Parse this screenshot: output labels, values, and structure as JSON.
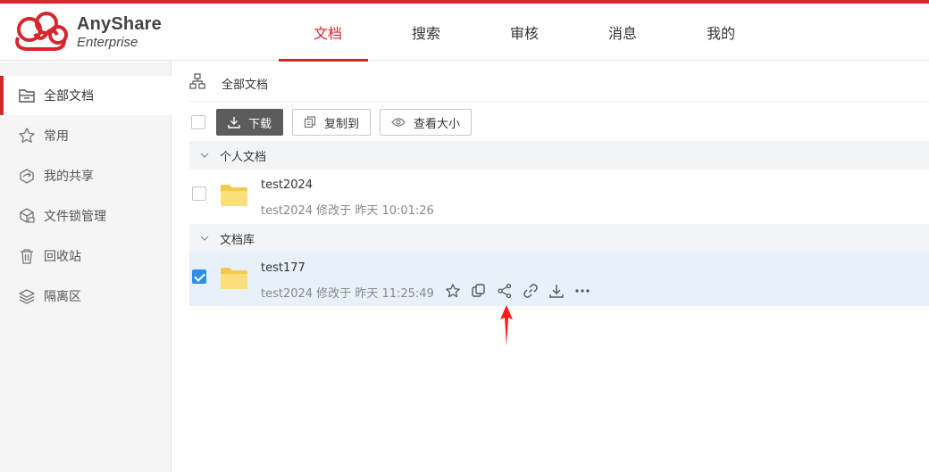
{
  "app": {
    "brand_name": "AnyShare",
    "brand_sub": "Enterprise",
    "accent_color": "#d9262c"
  },
  "nav": {
    "tabs": [
      {
        "label": "文档",
        "active": true
      },
      {
        "label": "搜索",
        "active": false
      },
      {
        "label": "审核",
        "active": false
      },
      {
        "label": "消息",
        "active": false
      },
      {
        "label": "我的",
        "active": false
      }
    ]
  },
  "sidebar": {
    "items": [
      {
        "label": "全部文档",
        "icon": "folder-drawer-icon",
        "active": true
      },
      {
        "label": "常用",
        "icon": "star-icon",
        "active": false
      },
      {
        "label": "我的共享",
        "icon": "share-box-icon",
        "active": false
      },
      {
        "label": "文件锁管理",
        "icon": "lock-cube-icon",
        "active": false
      },
      {
        "label": "回收站",
        "icon": "trash-icon",
        "active": false
      },
      {
        "label": "隔离区",
        "icon": "layers-icon",
        "active": false
      }
    ]
  },
  "breadcrumb": {
    "icon": "org-tree-icon",
    "label": "全部文档"
  },
  "toolbar": {
    "download_label": "下载",
    "copy_label": "复制到",
    "size_label": "查看大小"
  },
  "groups": [
    {
      "title": "个人文档",
      "items": [
        {
          "name": "test2024",
          "meta": "test2024 修改于 昨天 10:01:26",
          "checked": false
        }
      ]
    },
    {
      "title": "文档库",
      "items": [
        {
          "name": "test177",
          "meta": "test2024 修改于 昨天 11:25:49",
          "checked": true
        }
      ]
    }
  ],
  "row_actions": [
    "star-icon",
    "copy-icon",
    "share-icon",
    "link-icon",
    "download-icon",
    "more-icon"
  ]
}
